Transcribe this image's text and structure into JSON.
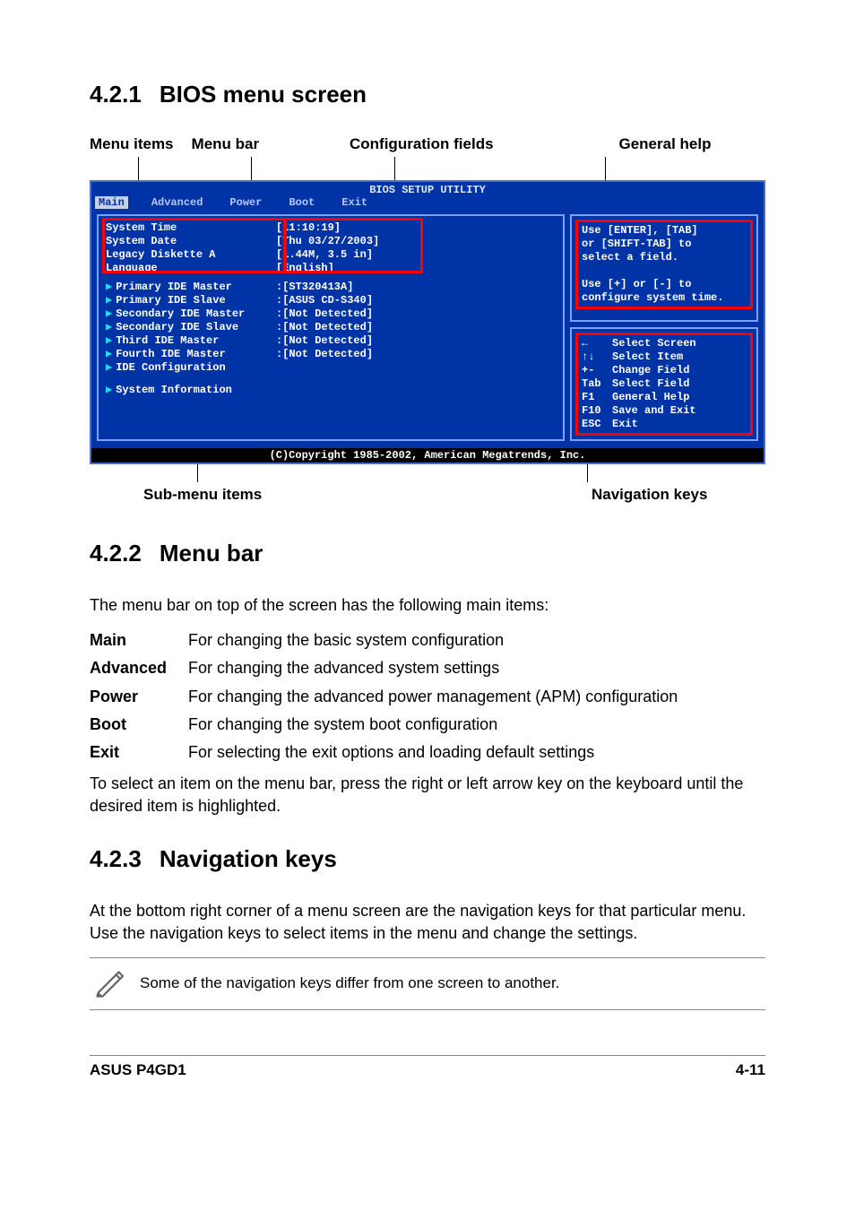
{
  "sections": {
    "s1": {
      "num": "4.2.1",
      "title": "BIOS menu screen"
    },
    "s2": {
      "num": "4.2.2",
      "title": "Menu bar"
    },
    "s3": {
      "num": "4.2.3",
      "title": "Navigation keys"
    }
  },
  "callouts": {
    "menu_items": "Menu items",
    "menu_bar": "Menu bar",
    "config_fields": "Configuration fields",
    "general_help": "General help",
    "sub_menu": "Sub-menu items",
    "nav_keys": "Navigation keys"
  },
  "bios": {
    "title": "BIOS SETUP UTILITY",
    "tabs": [
      "Main",
      "Advanced",
      "Power",
      "Boot",
      "Exit"
    ],
    "active_tab": "Main",
    "top_items": [
      {
        "label": "System Time",
        "value": "[11:10:19]"
      },
      {
        "label": "System Date",
        "value": "[Thu 03/27/2003]"
      },
      {
        "label": "Legacy Diskette A",
        "value": "[1.44M, 3.5 in]"
      },
      {
        "label": "Language",
        "value": "[English]"
      }
    ],
    "sub_items": [
      {
        "label": "Primary IDE Master",
        "value": ":[ST320413A]"
      },
      {
        "label": "Primary IDE Slave",
        "value": ":[ASUS CD-S340]"
      },
      {
        "label": "Secondary IDE Master",
        "value": ":[Not Detected]"
      },
      {
        "label": "Secondary IDE Slave",
        "value": ":[Not Detected]"
      },
      {
        "label": "Third IDE Master",
        "value": ":[Not Detected]"
      },
      {
        "label": "Fourth IDE Master",
        "value": ":[Not Detected]"
      },
      {
        "label": "IDE Configuration",
        "value": ""
      }
    ],
    "extra_item": {
      "label": "System Information",
      "value": ""
    },
    "help_text": "Use [ENTER], [TAB]\nor [SHIFT-TAB] to\nselect a field.\n\nUse [+] or [-] to\nconfigure system time.",
    "nav": [
      {
        "key": "←",
        "desc": "Select Screen"
      },
      {
        "key": "↑↓",
        "desc": "Select Item"
      },
      {
        "key": "+-",
        "desc": "Change Field"
      },
      {
        "key": "Tab",
        "desc": "Select Field"
      },
      {
        "key": "F1",
        "desc": "General Help"
      },
      {
        "key": "F10",
        "desc": "Save and Exit"
      },
      {
        "key": "ESC",
        "desc": "Exit"
      }
    ],
    "copyright": "(C)Copyright 1985-2002, American Megatrends, Inc."
  },
  "menubar_intro": "The menu bar on top of the screen has the following main items:",
  "menubar_defs": [
    {
      "term": "Main",
      "desc": "For changing the basic system configuration"
    },
    {
      "term": "Advanced",
      "desc": "For changing the advanced system settings"
    },
    {
      "term": "Power",
      "desc": "For changing the advanced power management (APM) configuration"
    },
    {
      "term": "Boot",
      "desc": "For changing the system boot configuration"
    },
    {
      "term": "Exit",
      "desc": "For selecting the exit options and loading default settings"
    }
  ],
  "menubar_tip": "To select an item on the menu bar, press the right or left arrow key on the keyboard until the desired item is highlighted.",
  "navkeys_para": "At the bottom right corner of a menu screen are the navigation keys for that particular menu. Use the navigation keys to select items in the menu and change the settings.",
  "note": "Some of the navigation keys differ from one screen to another.",
  "footer": {
    "left": "ASUS P4GD1",
    "right": "4-11"
  }
}
